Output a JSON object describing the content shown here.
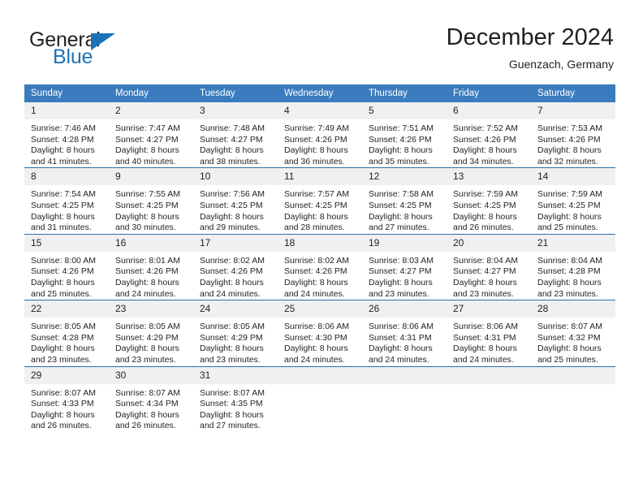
{
  "brand": {
    "name_top": "General",
    "name_bottom": "Blue",
    "accent_color": "#1b72b8",
    "triangle_icon": "brand-triangle-icon"
  },
  "header": {
    "title": "December 2024",
    "subtitle": "Guenzach, Germany"
  },
  "calendar": {
    "header_bg": "#3a7cbe",
    "header_text_color": "#ffffff",
    "daynum_bg": "#f0f0f0",
    "row_divider_color": "#2e6da4",
    "weekday_headers": [
      "Sunday",
      "Monday",
      "Tuesday",
      "Wednesday",
      "Thursday",
      "Friday",
      "Saturday"
    ],
    "weeks": [
      [
        {
          "day": "1",
          "sunrise": "Sunrise: 7:46 AM",
          "sunset": "Sunset: 4:28 PM",
          "daylight_line1": "Daylight: 8 hours",
          "daylight_line2": "and 41 minutes."
        },
        {
          "day": "2",
          "sunrise": "Sunrise: 7:47 AM",
          "sunset": "Sunset: 4:27 PM",
          "daylight_line1": "Daylight: 8 hours",
          "daylight_line2": "and 40 minutes."
        },
        {
          "day": "3",
          "sunrise": "Sunrise: 7:48 AM",
          "sunset": "Sunset: 4:27 PM",
          "daylight_line1": "Daylight: 8 hours",
          "daylight_line2": "and 38 minutes."
        },
        {
          "day": "4",
          "sunrise": "Sunrise: 7:49 AM",
          "sunset": "Sunset: 4:26 PM",
          "daylight_line1": "Daylight: 8 hours",
          "daylight_line2": "and 36 minutes."
        },
        {
          "day": "5",
          "sunrise": "Sunrise: 7:51 AM",
          "sunset": "Sunset: 4:26 PM",
          "daylight_line1": "Daylight: 8 hours",
          "daylight_line2": "and 35 minutes."
        },
        {
          "day": "6",
          "sunrise": "Sunrise: 7:52 AM",
          "sunset": "Sunset: 4:26 PM",
          "daylight_line1": "Daylight: 8 hours",
          "daylight_line2": "and 34 minutes."
        },
        {
          "day": "7",
          "sunrise": "Sunrise: 7:53 AM",
          "sunset": "Sunset: 4:26 PM",
          "daylight_line1": "Daylight: 8 hours",
          "daylight_line2": "and 32 minutes."
        }
      ],
      [
        {
          "day": "8",
          "sunrise": "Sunrise: 7:54 AM",
          "sunset": "Sunset: 4:25 PM",
          "daylight_line1": "Daylight: 8 hours",
          "daylight_line2": "and 31 minutes."
        },
        {
          "day": "9",
          "sunrise": "Sunrise: 7:55 AM",
          "sunset": "Sunset: 4:25 PM",
          "daylight_line1": "Daylight: 8 hours",
          "daylight_line2": "and 30 minutes."
        },
        {
          "day": "10",
          "sunrise": "Sunrise: 7:56 AM",
          "sunset": "Sunset: 4:25 PM",
          "daylight_line1": "Daylight: 8 hours",
          "daylight_line2": "and 29 minutes."
        },
        {
          "day": "11",
          "sunrise": "Sunrise: 7:57 AM",
          "sunset": "Sunset: 4:25 PM",
          "daylight_line1": "Daylight: 8 hours",
          "daylight_line2": "and 28 minutes."
        },
        {
          "day": "12",
          "sunrise": "Sunrise: 7:58 AM",
          "sunset": "Sunset: 4:25 PM",
          "daylight_line1": "Daylight: 8 hours",
          "daylight_line2": "and 27 minutes."
        },
        {
          "day": "13",
          "sunrise": "Sunrise: 7:59 AM",
          "sunset": "Sunset: 4:25 PM",
          "daylight_line1": "Daylight: 8 hours",
          "daylight_line2": "and 26 minutes."
        },
        {
          "day": "14",
          "sunrise": "Sunrise: 7:59 AM",
          "sunset": "Sunset: 4:25 PM",
          "daylight_line1": "Daylight: 8 hours",
          "daylight_line2": "and 25 minutes."
        }
      ],
      [
        {
          "day": "15",
          "sunrise": "Sunrise: 8:00 AM",
          "sunset": "Sunset: 4:26 PM",
          "daylight_line1": "Daylight: 8 hours",
          "daylight_line2": "and 25 minutes."
        },
        {
          "day": "16",
          "sunrise": "Sunrise: 8:01 AM",
          "sunset": "Sunset: 4:26 PM",
          "daylight_line1": "Daylight: 8 hours",
          "daylight_line2": "and 24 minutes."
        },
        {
          "day": "17",
          "sunrise": "Sunrise: 8:02 AM",
          "sunset": "Sunset: 4:26 PM",
          "daylight_line1": "Daylight: 8 hours",
          "daylight_line2": "and 24 minutes."
        },
        {
          "day": "18",
          "sunrise": "Sunrise: 8:02 AM",
          "sunset": "Sunset: 4:26 PM",
          "daylight_line1": "Daylight: 8 hours",
          "daylight_line2": "and 24 minutes."
        },
        {
          "day": "19",
          "sunrise": "Sunrise: 8:03 AM",
          "sunset": "Sunset: 4:27 PM",
          "daylight_line1": "Daylight: 8 hours",
          "daylight_line2": "and 23 minutes."
        },
        {
          "day": "20",
          "sunrise": "Sunrise: 8:04 AM",
          "sunset": "Sunset: 4:27 PM",
          "daylight_line1": "Daylight: 8 hours",
          "daylight_line2": "and 23 minutes."
        },
        {
          "day": "21",
          "sunrise": "Sunrise: 8:04 AM",
          "sunset": "Sunset: 4:28 PM",
          "daylight_line1": "Daylight: 8 hours",
          "daylight_line2": "and 23 minutes."
        }
      ],
      [
        {
          "day": "22",
          "sunrise": "Sunrise: 8:05 AM",
          "sunset": "Sunset: 4:28 PM",
          "daylight_line1": "Daylight: 8 hours",
          "daylight_line2": "and 23 minutes."
        },
        {
          "day": "23",
          "sunrise": "Sunrise: 8:05 AM",
          "sunset": "Sunset: 4:29 PM",
          "daylight_line1": "Daylight: 8 hours",
          "daylight_line2": "and 23 minutes."
        },
        {
          "day": "24",
          "sunrise": "Sunrise: 8:05 AM",
          "sunset": "Sunset: 4:29 PM",
          "daylight_line1": "Daylight: 8 hours",
          "daylight_line2": "and 23 minutes."
        },
        {
          "day": "25",
          "sunrise": "Sunrise: 8:06 AM",
          "sunset": "Sunset: 4:30 PM",
          "daylight_line1": "Daylight: 8 hours",
          "daylight_line2": "and 24 minutes."
        },
        {
          "day": "26",
          "sunrise": "Sunrise: 8:06 AM",
          "sunset": "Sunset: 4:31 PM",
          "daylight_line1": "Daylight: 8 hours",
          "daylight_line2": "and 24 minutes."
        },
        {
          "day": "27",
          "sunrise": "Sunrise: 8:06 AM",
          "sunset": "Sunset: 4:31 PM",
          "daylight_line1": "Daylight: 8 hours",
          "daylight_line2": "and 24 minutes."
        },
        {
          "day": "28",
          "sunrise": "Sunrise: 8:07 AM",
          "sunset": "Sunset: 4:32 PM",
          "daylight_line1": "Daylight: 8 hours",
          "daylight_line2": "and 25 minutes."
        }
      ],
      [
        {
          "day": "29",
          "sunrise": "Sunrise: 8:07 AM",
          "sunset": "Sunset: 4:33 PM",
          "daylight_line1": "Daylight: 8 hours",
          "daylight_line2": "and 26 minutes."
        },
        {
          "day": "30",
          "sunrise": "Sunrise: 8:07 AM",
          "sunset": "Sunset: 4:34 PM",
          "daylight_line1": "Daylight: 8 hours",
          "daylight_line2": "and 26 minutes."
        },
        {
          "day": "31",
          "sunrise": "Sunrise: 8:07 AM",
          "sunset": "Sunset: 4:35 PM",
          "daylight_line1": "Daylight: 8 hours",
          "daylight_line2": "and 27 minutes."
        },
        {
          "day": "",
          "sunrise": "",
          "sunset": "",
          "daylight_line1": "",
          "daylight_line2": ""
        },
        {
          "day": "",
          "sunrise": "",
          "sunset": "",
          "daylight_line1": "",
          "daylight_line2": ""
        },
        {
          "day": "",
          "sunrise": "",
          "sunset": "",
          "daylight_line1": "",
          "daylight_line2": ""
        },
        {
          "day": "",
          "sunrise": "",
          "sunset": "",
          "daylight_line1": "",
          "daylight_line2": ""
        }
      ]
    ]
  }
}
